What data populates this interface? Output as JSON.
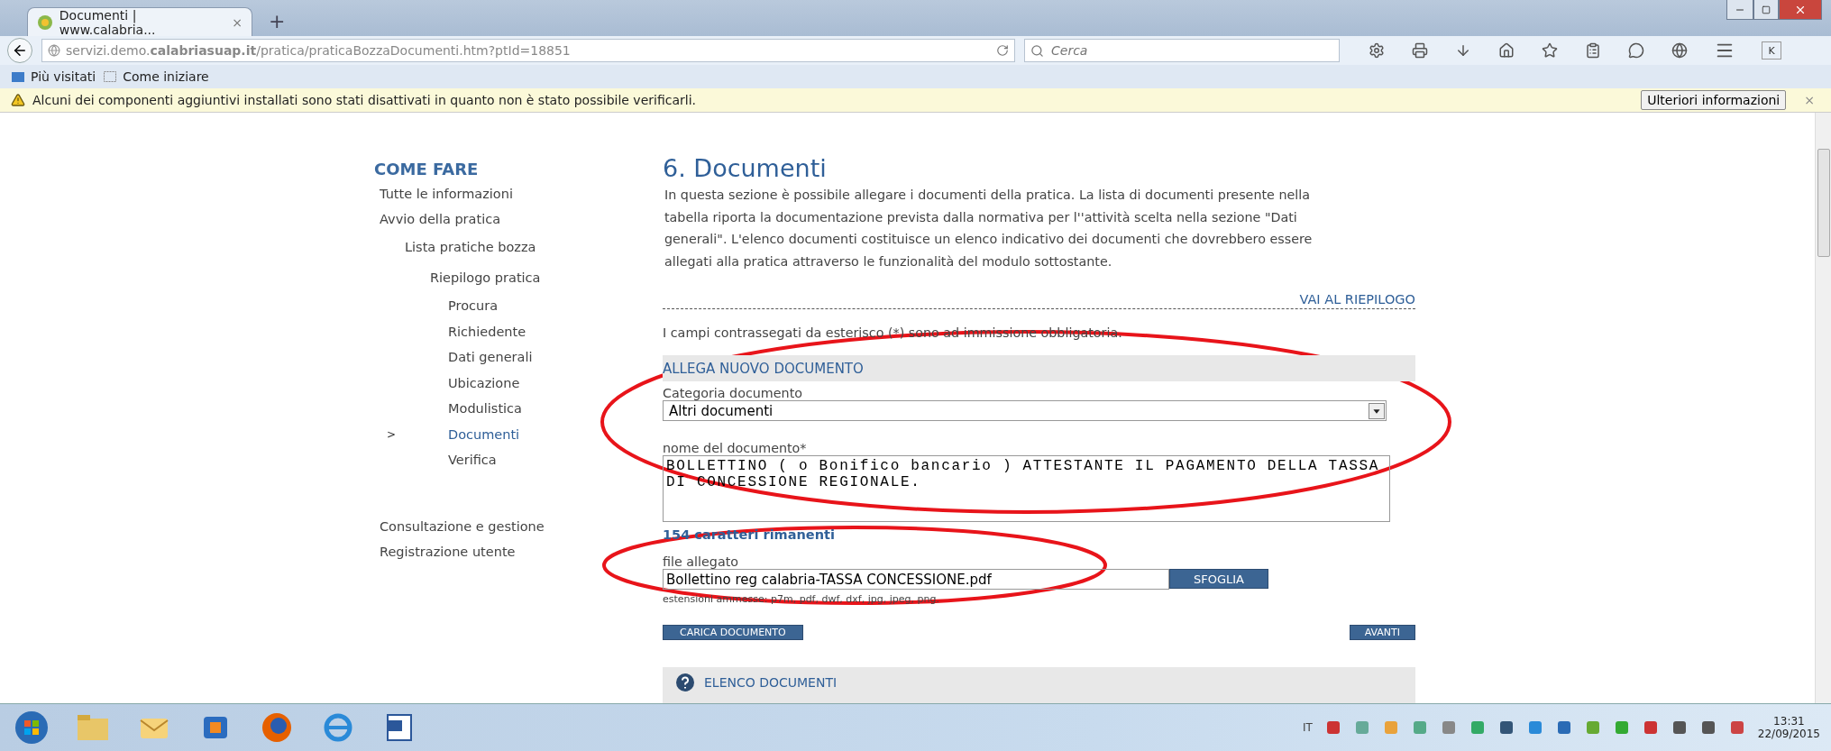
{
  "browser": {
    "tab": {
      "title": "Documenti | www.calabria...",
      "close": "×"
    },
    "new_tab": "+",
    "address": "servizi.demo.**calabriasuap.it**/pratica/praticaBozzaDocumenti.htm?ptId=18851",
    "search": {
      "placeholder": "Cerca"
    },
    "extension_badge": "K",
    "bookmarks": [
      {
        "label": "Più visitati",
        "kind": "folder"
      },
      {
        "label": "Come iniziare",
        "kind": "page"
      }
    ],
    "notification": {
      "message": "Alcuni dei componenti aggiuntivi installati sono stati disattivati in quanto non è stato possibile verificarli.",
      "button": "Ulteriori informazioni",
      "close": "×"
    }
  },
  "sidebar": {
    "title": "COME FARE",
    "selected_marker": ">",
    "items": [
      {
        "label": "Tutte le informazioni",
        "selected": false
      },
      {
        "label": "Avvio della pratica",
        "selected": false,
        "children": [
          {
            "label": "Lista pratiche bozza",
            "selected": false,
            "children": [
              {
                "label": "Riepilogo pratica",
                "selected": false,
                "children": [
                  {
                    "label": "Procura",
                    "selected": false
                  },
                  {
                    "label": "Richiedente",
                    "selected": false
                  },
                  {
                    "label": "Dati generali",
                    "selected": false
                  },
                  {
                    "label": "Ubicazione",
                    "selected": false
                  },
                  {
                    "label": "Modulistica",
                    "selected": false
                  },
                  {
                    "label": "Documenti",
                    "selected": true
                  },
                  {
                    "label": "Verifica",
                    "selected": false
                  }
                ]
              }
            ]
          }
        ]
      },
      {
        "label": "Consultazione e gestione",
        "selected": false,
        "gap": true
      },
      {
        "label": "Registrazione utente",
        "selected": false
      }
    ]
  },
  "content": {
    "title": "6. Documenti",
    "intro": "In questa sezione è possibile allegare i documenti della pratica. La lista di documenti presente nella tabella riporta la documentazione prevista dalla normativa per l''attività scelta nella sezione \"Dati generali\". L'elenco documenti costituisce un elenco indicativo dei documenti che dovrebbero essere allegati alla pratica attraverso le funzionalità del modulo sottostante.",
    "summary_link": "VAI AL RIEPILOGO",
    "required_note": "I campi contrassegati da esterisco (*) sono ad immissione obbligatoria.",
    "form": {
      "heading": "ALLEGA NUOVO DOCUMENTO",
      "category": {
        "label": "Categoria documento",
        "value": "Altri documenti"
      },
      "name": {
        "label": "nome del documento*",
        "value": "BOLLETTINO ( o Bonifico bancario ) ATTESTANTE IL PAGAMENTO DELLA TASSA DI CONCESSIONE REGIONALE."
      },
      "remaining": "154 caratteri rimanenti",
      "file": {
        "label": "file allegato",
        "value": "Bollettino reg calabria-TASSA CONCESSIONE.pdf",
        "button": "SFOGLIA",
        "hint": "estensioni ammesse: p7m, pdf, dwf, dxf, jpg, jpeg, png."
      },
      "buttons": [
        "CARICA DOCUMENTO",
        "AVANTI"
      ]
    },
    "list_section": {
      "title": "ELENCO DOCUMENTI"
    }
  },
  "taskbar": {
    "language": "IT",
    "time": "13:31",
    "date": "22/09/2015"
  }
}
